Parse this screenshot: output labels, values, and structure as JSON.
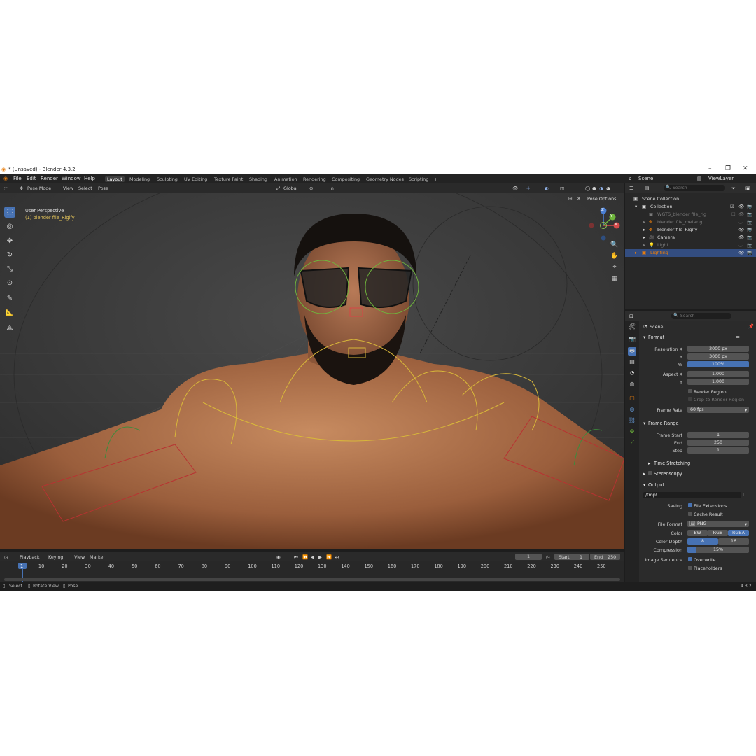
{
  "window": {
    "title": "* (Unsaved) - Blender 4.3.2"
  },
  "menu": [
    "File",
    "Edit",
    "Render",
    "Window",
    "Help"
  ],
  "workspaces": [
    "Layout",
    "Modeling",
    "Sculpting",
    "UV Editing",
    "Texture Paint",
    "Shading",
    "Animation",
    "Rendering",
    "Compositing",
    "Geometry Nodes",
    "Scripting"
  ],
  "workspace_add": "+",
  "scene_name": "Scene",
  "view_layer": "ViewLayer",
  "viewport": {
    "mode": "Pose Mode",
    "menus": [
      "View",
      "Select",
      "Pose"
    ],
    "transform": "Global",
    "pose_options": "Pose Options",
    "perspective": "User Perspective",
    "object_label": "(1) blender file_Rigify"
  },
  "gizmo": {
    "z": "Z",
    "x": "X",
    "y": "Y"
  },
  "outliner": {
    "search_placeholder": "Search",
    "root": "Scene Collection",
    "collection": "Collection",
    "items": [
      "WGTS_blender file_rig",
      "blender file_metarig",
      "blender file_Rigify",
      "Camera",
      "Light",
      "Lighting"
    ]
  },
  "properties": {
    "search_placeholder": "Search",
    "context": "Scene",
    "format_section": "Format",
    "resolution_x_label": "Resolution X",
    "resolution_x": "2000 px",
    "y_label": "Y",
    "resolution_y": "3000 px",
    "pct_label": "%",
    "resolution_pct": "100%",
    "aspect_x_label": "Aspect X",
    "aspect_x": "1.000",
    "aspect_y": "1.000",
    "render_region": "Render Region",
    "crop_region": "Crop to Render Region",
    "frame_rate_label": "Frame Rate",
    "frame_rate": "60 fps",
    "frame_range_section": "Frame Range",
    "frame_start_label": "Frame Start",
    "frame_start": "1",
    "end_label": "End",
    "frame_end": "250",
    "step_label": "Step",
    "frame_step": "1",
    "time_stretching": "Time Stretching",
    "stereoscopy": "Stereoscopy",
    "output_section": "Output",
    "output_path": "/tmp\\",
    "saving_label": "Saving",
    "file_extensions": "File Extensions",
    "cache_result": "Cache Result",
    "file_format_label": "File Format",
    "file_format": "PNG",
    "color_label": "Color",
    "color_options": [
      "BW",
      "RGB",
      "RGBA"
    ],
    "color_depth_label": "Color Depth",
    "color_depth_options": [
      "8",
      "16"
    ],
    "compression_label": "Compression",
    "compression": "15%",
    "image_sequence_label": "Image Sequence",
    "overwrite": "Overwrite",
    "placeholders": "Placeholders"
  },
  "timeline": {
    "menus": [
      "Playback",
      "Keying",
      "View",
      "Marker"
    ],
    "current_frame": "1",
    "start_label": "Start",
    "start": "1",
    "end_label": "End",
    "end": "250",
    "ticks": [
      "1",
      "10",
      "20",
      "30",
      "40",
      "50",
      "60",
      "70",
      "80",
      "90",
      "100",
      "110",
      "120",
      "130",
      "140",
      "150",
      "160",
      "170",
      "180",
      "190",
      "200",
      "210",
      "220",
      "230",
      "240",
      "250"
    ]
  },
  "status": {
    "select": "Select",
    "rotate": "Rotate View",
    "pose": "Pose",
    "version": "4.3.2"
  },
  "colors": {
    "accent": "#4772b3",
    "brand": "#e87d0d",
    "selection_text": "#e2c35a"
  }
}
